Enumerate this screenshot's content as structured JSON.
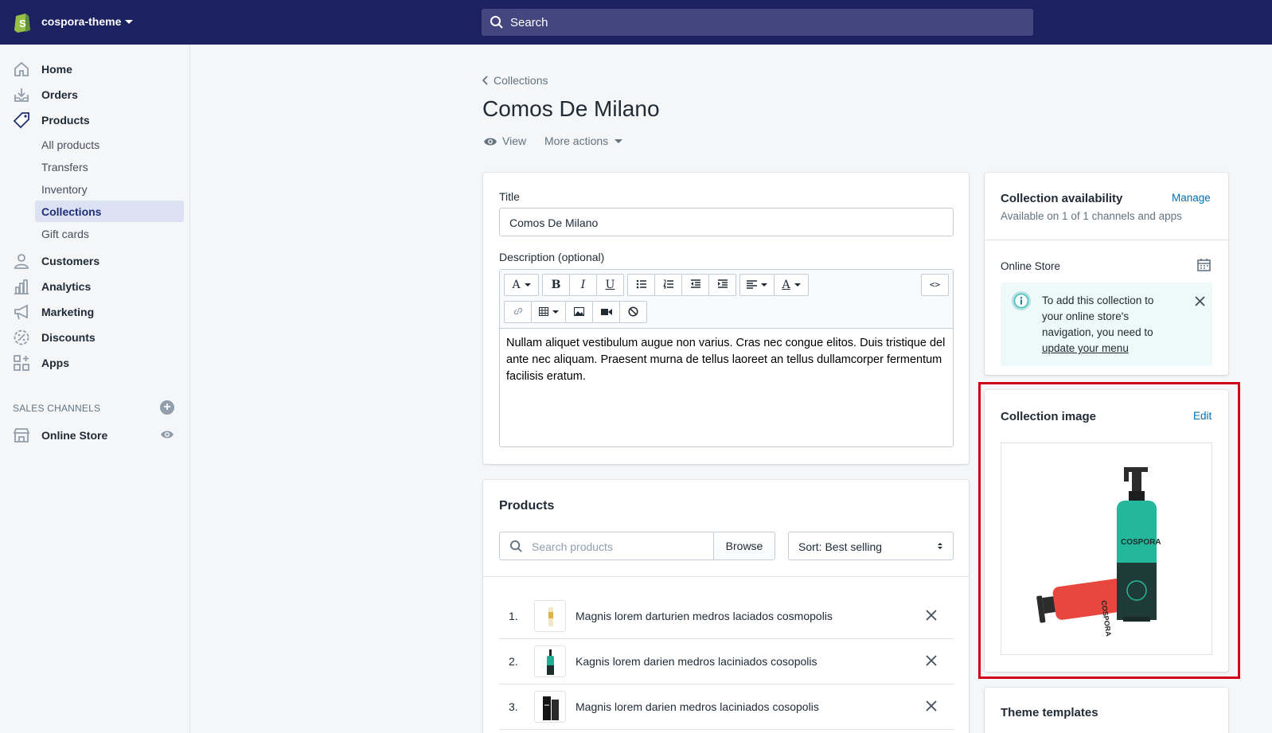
{
  "topbar": {
    "store_name": "cospora-theme",
    "search_placeholder": "Search",
    "bg_color": "#1c2260"
  },
  "sidebar": {
    "items": [
      {
        "label": "Home",
        "icon": "home-icon"
      },
      {
        "label": "Orders",
        "icon": "orders-icon"
      },
      {
        "label": "Products",
        "icon": "tag-icon"
      }
    ],
    "product_subitems": [
      {
        "label": "All products"
      },
      {
        "label": "Transfers"
      },
      {
        "label": "Inventory"
      },
      {
        "label": "Collections",
        "active": true
      },
      {
        "label": "Gift cards"
      }
    ],
    "items_after": [
      {
        "label": "Customers",
        "icon": "customer-icon"
      },
      {
        "label": "Analytics",
        "icon": "analytics-icon"
      },
      {
        "label": "Marketing",
        "icon": "megaphone-icon"
      },
      {
        "label": "Discounts",
        "icon": "discount-icon"
      },
      {
        "label": "Apps",
        "icon": "apps-icon"
      }
    ],
    "channels_heading": "SALES CHANNELS",
    "channels": [
      {
        "label": "Online Store",
        "icon": "store-icon"
      }
    ]
  },
  "page": {
    "breadcrumb": "Collections",
    "title": "Comos De Milano",
    "view_label": "View",
    "more_actions_label": "More actions"
  },
  "form": {
    "title_label": "Title",
    "title_value": "Comos De Milano",
    "description_label": "Description (optional)",
    "description_text": "Nullam aliquet vestibulum augue non varius. Cras nec congue elitos. Duis tristique del ante nec aliquam. Praesent murna de tellus laoreet an tellus dullamcorper fermentum facilisis eratum."
  },
  "products": {
    "heading": "Products",
    "search_placeholder": "Search products",
    "browse_label": "Browse",
    "sort_label": "Sort: Best selling",
    "rows": [
      {
        "index": "1.",
        "name": "Magnis lorem darturien medros laciados cosmopolis"
      },
      {
        "index": "2.",
        "name": "Kagnis lorem darien medros laciniados cosopolis"
      },
      {
        "index": "3.",
        "name": "Magnis lorem darien medros laciniados cosopolis"
      }
    ]
  },
  "availability": {
    "heading": "Collection availability",
    "manage_label": "Manage",
    "subtitle": "Available on 1 of 1 channels and apps",
    "channel_name": "Online Store",
    "notice_text": "To add this collection to your online store's navigation, you need to ",
    "notice_link": "update your menu"
  },
  "collection_image": {
    "heading": "Collection image",
    "edit_label": "Edit",
    "bottle_brand": "COSPORA",
    "highlight_color": "#d0021b"
  },
  "theme_templates": {
    "heading": "Theme templates"
  }
}
